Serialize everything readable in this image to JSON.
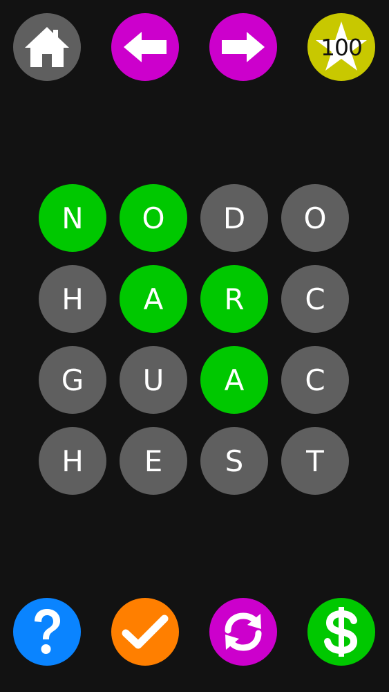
{
  "colors": {
    "background": "#121212",
    "tile_default": "#5f5f5f",
    "tile_selected": "#00c800",
    "home_button": "#5f5f5f",
    "nav_button": "#cc00cc",
    "score_badge": "#c8c800",
    "hint_button": "#0a84ff",
    "submit_button": "#ff7f00",
    "shuffle_button": "#cc00cc",
    "store_button": "#00c800"
  },
  "header": {
    "home_icon": "house-icon",
    "prev_icon": "arrow-left-icon",
    "next_icon": "arrow-right-icon",
    "score": "100",
    "score_icon": "star-icon"
  },
  "board": {
    "rows": [
      [
        {
          "letter": "N",
          "selected": true
        },
        {
          "letter": "O",
          "selected": true
        },
        {
          "letter": "D",
          "selected": false
        },
        {
          "letter": "O",
          "selected": false
        }
      ],
      [
        {
          "letter": "H",
          "selected": false
        },
        {
          "letter": "A",
          "selected": true
        },
        {
          "letter": "R",
          "selected": true
        },
        {
          "letter": "C",
          "selected": false
        }
      ],
      [
        {
          "letter": "G",
          "selected": false
        },
        {
          "letter": "U",
          "selected": false
        },
        {
          "letter": "A",
          "selected": true
        },
        {
          "letter": "C",
          "selected": false
        }
      ],
      [
        {
          "letter": "H",
          "selected": false
        },
        {
          "letter": "E",
          "selected": false
        },
        {
          "letter": "S",
          "selected": false
        },
        {
          "letter": "T",
          "selected": false
        }
      ]
    ]
  },
  "footer": {
    "hint_icon": "question-mark-icon",
    "submit_icon": "checkmark-icon",
    "shuffle_icon": "refresh-icon",
    "store_icon": "dollar-icon"
  }
}
